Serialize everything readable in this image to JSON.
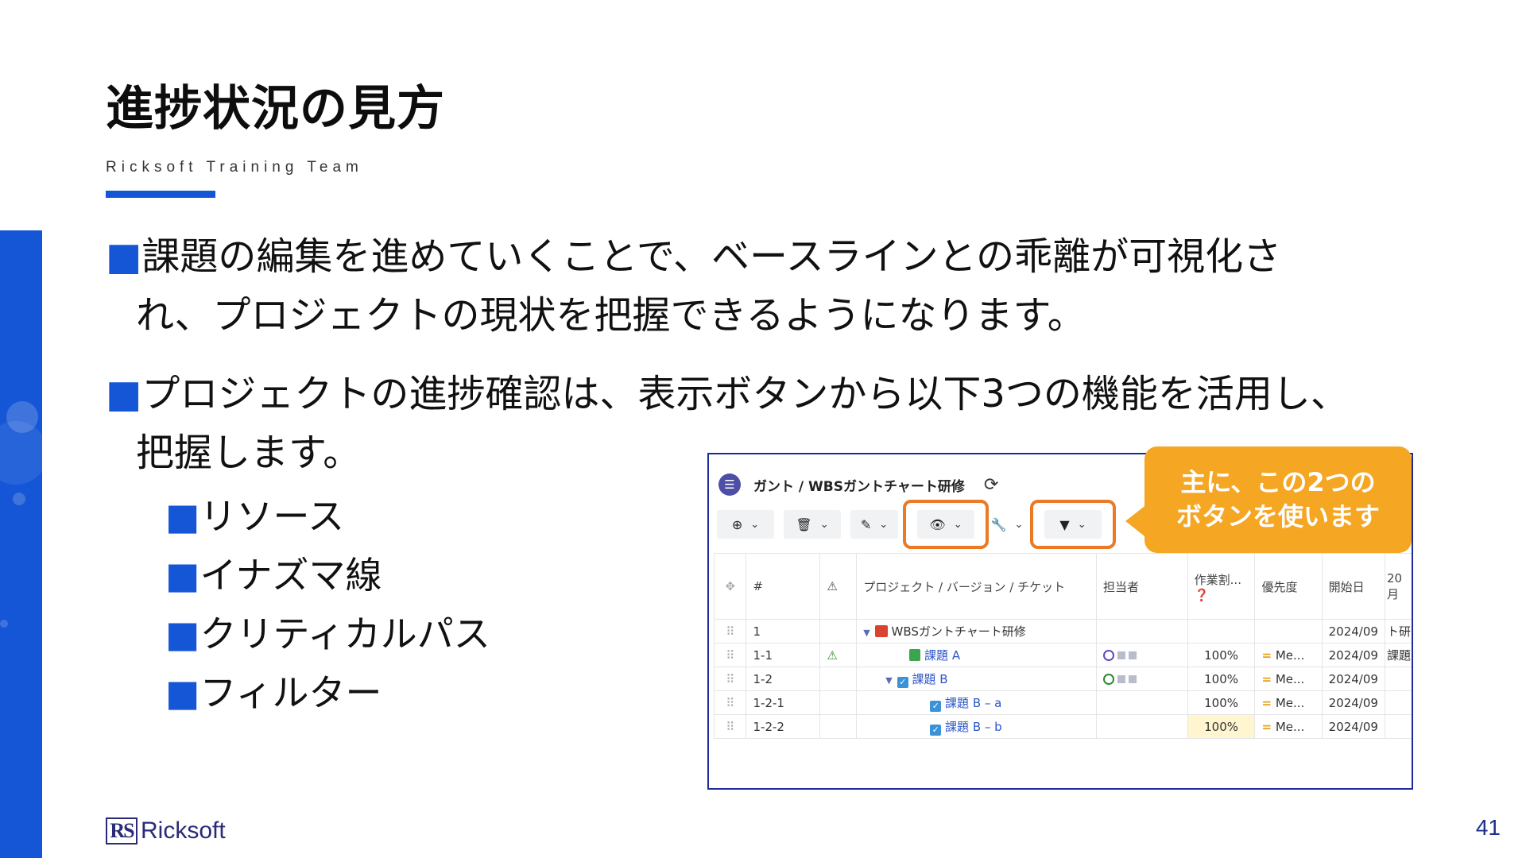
{
  "slide": {
    "title": "進捗状況の見方",
    "subtitle": "Ricksoft Training Team",
    "page_number": "41",
    "logo_mark": "RS",
    "logo_text": "Ricksoft"
  },
  "bullets": {
    "b1_line1": "課題の編集を進めていくことで、ベースラインとの乖離が可視化さ",
    "b1_line2": "れ、プロジェクトの現状を把握できるようになります。",
    "b2_line1": "プロジェクトの進捗確認は、表示ボタンから以下3つの機能を活用し、",
    "b2_line2": "把握します。",
    "square": "■",
    "sub": [
      "リソース",
      "イナズマ線",
      "クリティカルパス",
      "フィルター"
    ]
  },
  "callout": {
    "line1": "主に、この2つの",
    "line2": "ボタンを使います",
    "color": "#f5a623"
  },
  "app": {
    "breadcrumb": "ガント / WBSガントチャート研修",
    "toolbar": [
      "add-icon",
      "delete-icon",
      "edit-icon",
      "view-icon",
      "tools-icon",
      "filter-icon"
    ],
    "highlight_color": "#ea7a24",
    "columns": [
      "#",
      "プロジェクト / バージョン / チケット",
      "担当者",
      "作業割...",
      "優先度",
      "開始日"
    ],
    "col_extra_top": "20",
    "col_extra_bottom": "月",
    "rows": [
      {
        "num": "1",
        "name": "WBSガントチャート研修",
        "progress": "",
        "priority": "",
        "start": "2024/09",
        "extra": "ト研"
      },
      {
        "num": "1-1",
        "name": "課題 A",
        "progress": "100%",
        "priority": "Me...",
        "start": "2024/09",
        "extra": "課題"
      },
      {
        "num": "1-2",
        "name": "課題 B",
        "progress": "100%",
        "priority": "Me...",
        "start": "2024/09",
        "extra": ""
      },
      {
        "num": "1-2-1",
        "name": "課題 B – a",
        "progress": "100%",
        "priority": "Me...",
        "start": "2024/09",
        "extra": ""
      },
      {
        "num": "1-2-2",
        "name": "課題 B – b",
        "progress": "100%",
        "priority": "Me...",
        "start": "2024/09",
        "extra": ""
      }
    ]
  }
}
